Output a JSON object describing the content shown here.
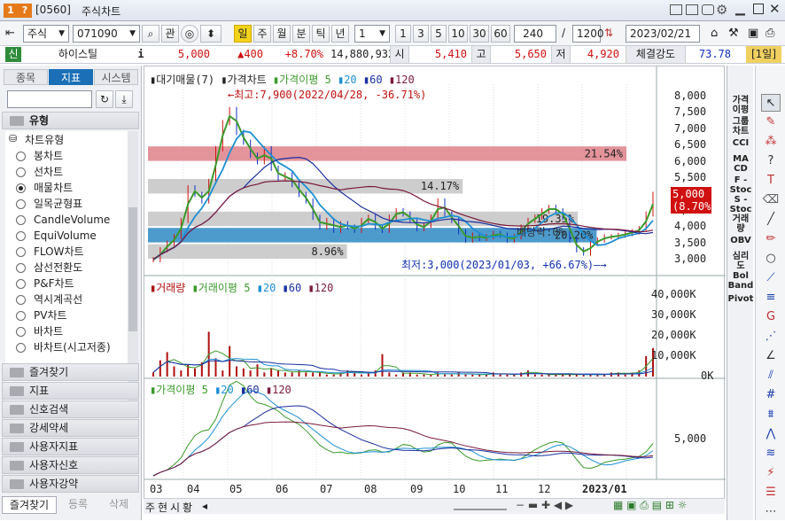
{
  "window": {
    "code": "[0560]",
    "title": "주식차트"
  },
  "toolbar": {
    "market": "주식",
    "code": "071090",
    "btn_relation": "관",
    "periods": [
      "일",
      "주",
      "월",
      "분",
      "틱",
      "년"
    ],
    "count_select": "1",
    "steps": [
      "1",
      "3",
      "5",
      "10",
      "30",
      "60"
    ],
    "view_count": "240",
    "total_count": "1200",
    "date": "2023/02/21"
  },
  "quote": {
    "badge": "신",
    "name": "하이스틸",
    "info_icon": "i",
    "price": "5,000",
    "change": "▲400",
    "change_pct": "+8.70%",
    "volume": "14,880,932",
    "open_label": "시",
    "open": "5,410",
    "high_label": "고",
    "high": "5,650",
    "low_label": "저",
    "low": "4,920",
    "strength_label": "체결강도",
    "strength": "73.78",
    "period_badge": "[1일]"
  },
  "left": {
    "tabs": [
      "종목",
      "지표",
      "시스템"
    ],
    "active_tab": "지표",
    "section": "유형",
    "tree_root": "차트유형",
    "items": [
      {
        "label": "봉차트",
        "on": false
      },
      {
        "label": "선차트",
        "on": false
      },
      {
        "label": "매물차트",
        "on": true
      },
      {
        "label": "일목균형표",
        "on": false
      },
      {
        "label": "CandleVolume",
        "on": false
      },
      {
        "label": "EquiVolume",
        "on": false
      },
      {
        "label": "FLOW차트",
        "on": false
      },
      {
        "label": "삼선전환도",
        "on": false
      },
      {
        "label": "P&F차트",
        "on": false
      },
      {
        "label": "역시계곡선",
        "on": false
      },
      {
        "label": "PV차트",
        "on": false
      },
      {
        "label": "바차트",
        "on": false
      },
      {
        "label": "바차트(시고저종)",
        "on": false
      }
    ],
    "categories": [
      "즐겨찾기",
      "지표",
      "신호검색",
      "강세약세",
      "사용자지표",
      "사용자신호",
      "사용자강약"
    ],
    "bottom_tabs": [
      "즐겨찾기",
      "등록",
      "삭제"
    ]
  },
  "chart": {
    "legend1": [
      "대기매물(7)",
      "가격차트",
      "가격이평 5",
      "20",
      "60",
      "120"
    ],
    "legend2": [
      "거래량",
      "거래이평 5",
      "20",
      "60",
      "120"
    ],
    "legend3": [
      "가격이평 5",
      "20",
      "60",
      "120"
    ],
    "high_note": "←최고:7,900(2022/04/28, -36.71%)",
    "low_note": "최저:3,000(2023/01/03, +66.67%)—→",
    "mid_note": "배당락:0%",
    "price_axis": [
      "8,000",
      "7,500",
      "7,000",
      "6,500",
      "6,000",
      "5,500",
      "5,000",
      "4,500",
      "4,000",
      "3,500",
      "3,000"
    ],
    "vol_axis": [
      "40,000K",
      "30,000K",
      "20,000K",
      "10,000K",
      "0K"
    ],
    "ma_axis": [
      "5,000"
    ],
    "last_price": "5,000",
    "last_pct": "(8.70%)",
    "months": [
      "03",
      "04",
      "05",
      "06",
      "07",
      "08",
      "09",
      "10",
      "11",
      "12",
      "2023/01"
    ],
    "bottom_tabs": [
      "주",
      "현",
      "시",
      "황"
    ],
    "colors": {
      "ma5": "#3a9a2a",
      "ma20": "#1c8fd4",
      "ma60": "#1a2fa0",
      "ma120": "#7a1a3a",
      "vol": "#b01010",
      "band": "#c8c8c8",
      "band_hi": "#e08890",
      "band_cur": "#3a90c8"
    }
  },
  "chart_data": {
    "type": "line",
    "profile": [
      {
        "from": 3000,
        "to": 3500,
        "pct": 8.96
      },
      {
        "from": 3500,
        "to": 4000,
        "pct": 20.2
      },
      {
        "from": 4000,
        "to": 4500,
        "pct": 19.35
      },
      {
        "from": 5000,
        "to": 5500,
        "pct": 14.17
      },
      {
        "from": 6000,
        "to": 6500,
        "pct": 21.54
      }
    ],
    "price": [
      3000,
      3300,
      3500,
      3700,
      4200,
      5200,
      5000,
      4800,
      5400,
      6400,
      7200,
      7600,
      6900,
      6600,
      6200,
      6000,
      6400,
      5800,
      5500,
      5600,
      5300,
      5000,
      4800,
      4300,
      4000,
      4200,
      3900,
      4100,
      4000,
      3900,
      4200,
      4300,
      4000,
      3900,
      4300,
      4500,
      4400,
      4200,
      3950,
      4050,
      4300,
      4800,
      4400,
      4200,
      3850,
      3600,
      3750,
      3650,
      3700,
      3800,
      3750,
      3600,
      3700,
      4000,
      4200,
      4300,
      4500,
      4600,
      4500,
      4300,
      3600,
      3300,
      3200,
      3500,
      3600,
      3700,
      3700,
      3750,
      3800,
      3850,
      3950,
      4400,
      5000
    ],
    "volume_k": [
      2,
      8,
      12,
      5,
      3,
      6,
      4,
      7,
      22,
      9,
      3,
      15,
      5,
      4,
      3,
      6,
      2,
      4,
      3,
      2,
      2,
      3,
      2,
      2,
      2,
      1,
      1,
      2,
      3,
      2,
      1,
      2,
      3,
      11,
      2,
      1,
      2,
      2,
      1,
      1,
      1,
      2,
      1,
      1,
      2,
      1,
      1,
      1,
      1,
      2,
      1,
      1,
      1,
      2,
      3,
      1,
      1,
      1,
      1,
      1,
      1,
      1,
      1,
      1,
      1,
      1,
      2,
      2,
      1,
      2,
      3,
      10,
      14
    ],
    "ylim": [
      3000,
      8000
    ]
  }
}
